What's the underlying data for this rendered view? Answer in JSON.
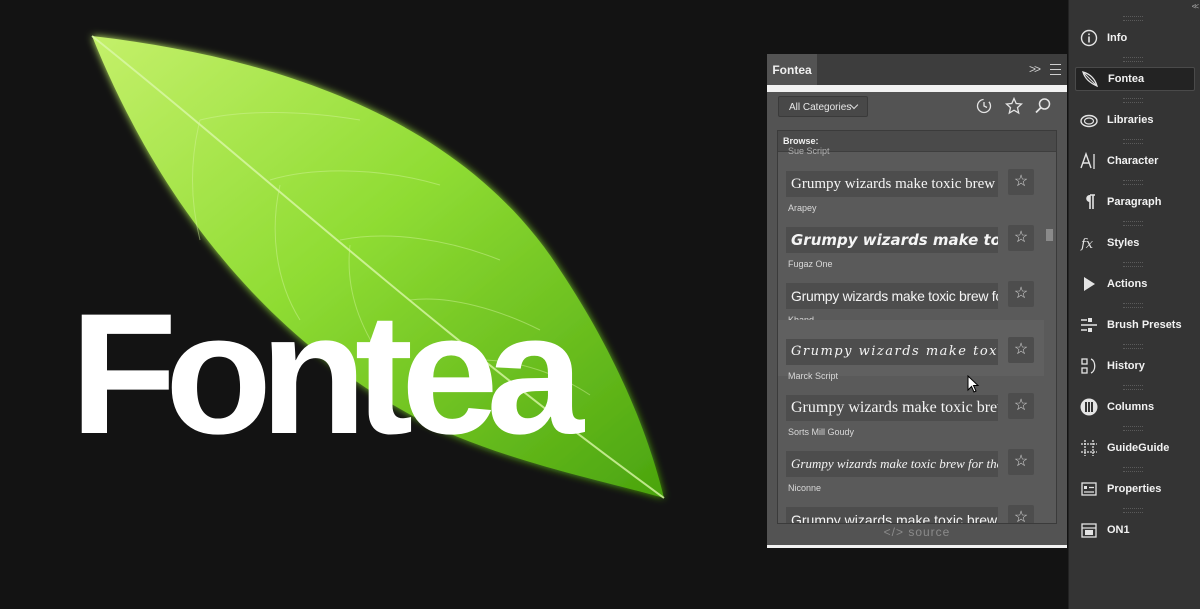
{
  "canvas": {
    "logo_text": "Fontea"
  },
  "panel": {
    "tab": "Fontea",
    "category_select": "All Categories",
    "toolbar_icons": [
      "history-icon",
      "star-icon",
      "search-icon"
    ],
    "browse_label": "Browse:",
    "partial_top_name": "Sue Script",
    "fonts": [
      {
        "preview": "Grumpy wizards make toxic brew for the evil queen",
        "name": "Arapey"
      },
      {
        "preview": "Grumpy wizards make toxic brew",
        "name": "Fugaz One"
      },
      {
        "preview": "Grumpy wizards make toxic brew for the evil queen",
        "name": "Khand"
      },
      {
        "preview": "Grumpy wizards make toxic brew",
        "name": "Marck Script"
      },
      {
        "preview": "Grumpy wizards make toxic brew",
        "name": "Sorts Mill Goudy"
      },
      {
        "preview": "Grumpy wizards make toxic brew for the evil queen",
        "name": "Niconne"
      },
      {
        "preview": "Grumpy wizards make toxic brew",
        "name": ""
      }
    ],
    "footer": "</> source"
  },
  "dock": {
    "items": [
      {
        "label": "Info",
        "icon": "info-icon"
      },
      {
        "label": "Fontea",
        "icon": "fontea-leaf-icon"
      },
      {
        "label": "Libraries",
        "icon": "libraries-icon"
      },
      {
        "label": "Character",
        "icon": "character-icon"
      },
      {
        "label": "Paragraph",
        "icon": "paragraph-icon"
      },
      {
        "label": "Styles",
        "icon": "styles-icon"
      },
      {
        "label": "Actions",
        "icon": "actions-play-icon"
      },
      {
        "label": "Brush Presets",
        "icon": "brush-presets-icon"
      },
      {
        "label": "History",
        "icon": "history-icon"
      },
      {
        "label": "Columns",
        "icon": "columns-icon"
      },
      {
        "label": "GuideGuide",
        "icon": "guideguide-icon"
      },
      {
        "label": "Properties",
        "icon": "properties-icon"
      },
      {
        "label": "ON1",
        "icon": "on1-icon"
      }
    ],
    "active_item": "Fontea"
  },
  "colors": {
    "canvas_bg": "#131313",
    "panel_bg": "#535353",
    "dock_bg": "#343434",
    "leaf_green": "#7ed321"
  }
}
